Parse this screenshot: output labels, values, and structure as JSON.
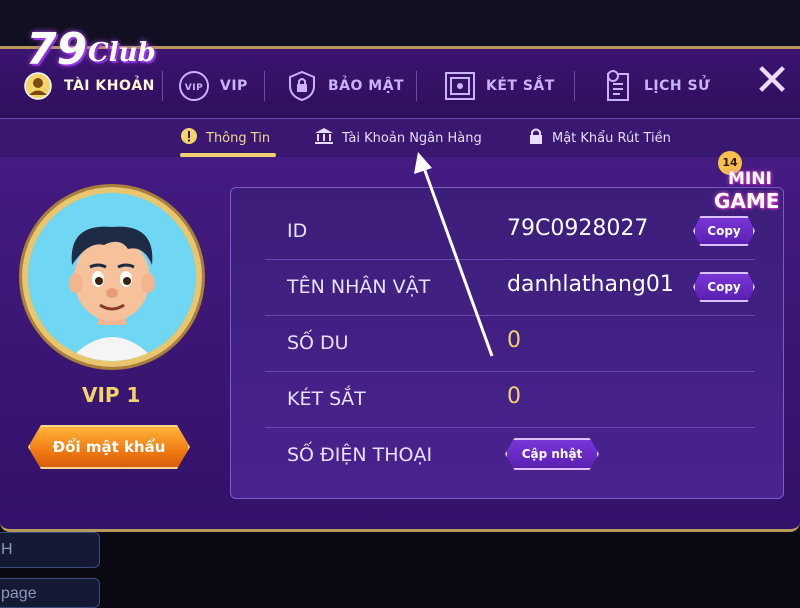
{
  "background": {
    "frag1": "H",
    "frag2": "page"
  },
  "topnav": {
    "account": "TÀI KHOẢN",
    "vip": "VIP",
    "security": "BẢO MẬT",
    "safe": "KÉT SẮT",
    "history": "LỊCH SỬ",
    "close_icon": "close-icon"
  },
  "logo": {
    "num": "79",
    "club": "Club"
  },
  "subnav": {
    "info": "Thông Tin",
    "bank": "Tài Khoản Ngân Hàng",
    "withdraw_pass": "Mật Khẩu Rút Tiền"
  },
  "minigame": {
    "badge": "14",
    "line1": "MINI",
    "line2": "GAME"
  },
  "profile": {
    "vip_level": "VIP 1",
    "change_password": "Đổi mật khẩu"
  },
  "info_rows": [
    {
      "label": "ID",
      "value": "79C0928027",
      "action": "Copy"
    },
    {
      "label": "TÊN NHÂN VẬT",
      "value": "danhlathang01",
      "action": "Copy"
    },
    {
      "label": "SỐ DU",
      "value": "0"
    },
    {
      "label": "KÉT SẮT",
      "value": "0"
    },
    {
      "label": "SỐ ĐIỆN THOẠI",
      "action": "Cập nhật"
    }
  ],
  "colors": {
    "accent": "#f4d36b",
    "primary": "#4a1f8a",
    "button_orange": "#f07a12"
  }
}
